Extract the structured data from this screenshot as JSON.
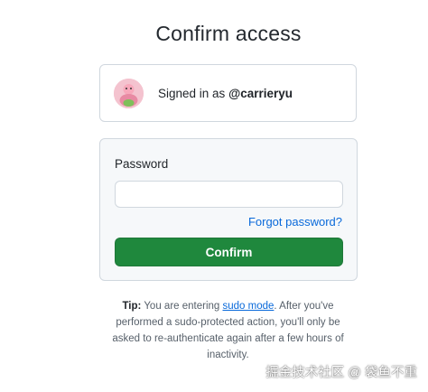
{
  "page": {
    "title": "Confirm access"
  },
  "account": {
    "prefix": "Signed in as ",
    "username": "@carrieryu",
    "avatar_icon": "avatar-cartoon-icon"
  },
  "form": {
    "password_label": "Password",
    "password_value": "",
    "forgot_link": "Forgot password?",
    "confirm_button": "Confirm"
  },
  "tip": {
    "label": "Tip:",
    "text_before": " You are entering ",
    "link": "sudo mode",
    "text_after": ". After you've performed a sudo-protected action, you'll only be asked to re-authenticate again after a few hours of inactivity."
  },
  "watermark": {
    "text": "掘金技术社区 @ 袋鱼不重"
  },
  "colors": {
    "primary_button": "#1f883d",
    "link": "#0969da",
    "border": "#d0d7de",
    "panel_bg": "#f6f8fa"
  }
}
